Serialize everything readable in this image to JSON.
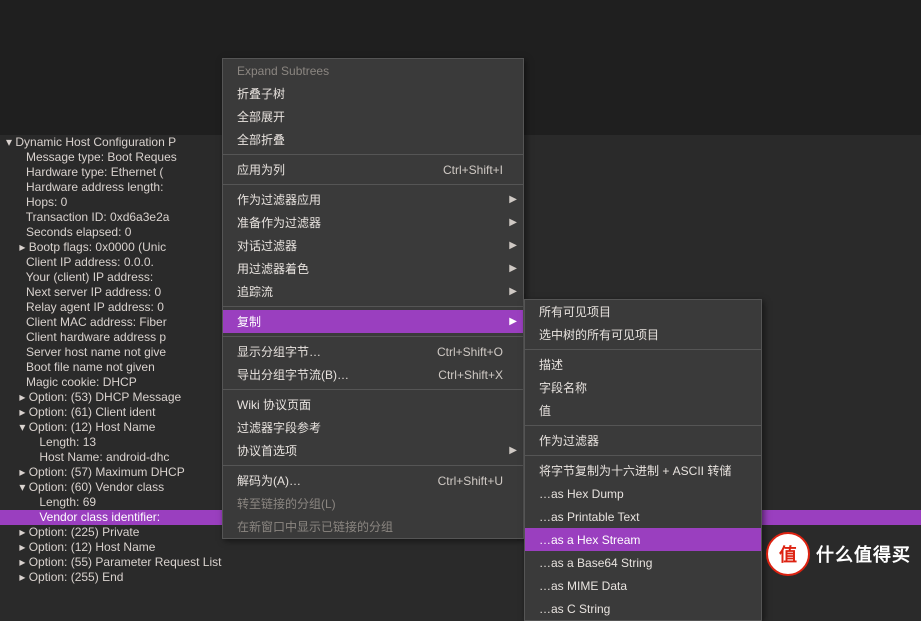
{
  "tree": [
    {
      "indent": 1,
      "caret": "▾",
      "text": "Dynamic Host Configuration P"
    },
    {
      "indent": 3,
      "caret": "",
      "text": "Message type: Boot Reques"
    },
    {
      "indent": 3,
      "caret": "",
      "text": "Hardware type: Ethernet ("
    },
    {
      "indent": 3,
      "caret": "",
      "text": "Hardware address length:"
    },
    {
      "indent": 3,
      "caret": "",
      "text": "Hops: 0"
    },
    {
      "indent": 3,
      "caret": "",
      "text": "Transaction ID: 0xd6a3e2a"
    },
    {
      "indent": 3,
      "caret": "",
      "text": "Seconds elapsed: 0"
    },
    {
      "indent": 3,
      "caret": "▸",
      "text": "Bootp flags: 0x0000 (Unic"
    },
    {
      "indent": 3,
      "caret": "",
      "text": "Client IP address: 0.0.0."
    },
    {
      "indent": 3,
      "caret": "",
      "text": "Your (client) IP address:"
    },
    {
      "indent": 3,
      "caret": "",
      "text": "Next server IP address: 0"
    },
    {
      "indent": 3,
      "caret": "",
      "text": "Relay agent IP address: 0"
    },
    {
      "indent": 3,
      "caret": "",
      "text": "Client MAC address: Fiber"
    },
    {
      "indent": 3,
      "caret": "",
      "text": "Client hardware address p"
    },
    {
      "indent": 3,
      "caret": "",
      "text": "Server host name not give"
    },
    {
      "indent": 3,
      "caret": "",
      "text": "Boot file name not given"
    },
    {
      "indent": 3,
      "caret": "",
      "text": "Magic cookie: DHCP"
    },
    {
      "indent": 3,
      "caret": "▸",
      "text": "Option: (53) DHCP Message"
    },
    {
      "indent": 3,
      "caret": "▸",
      "text": "Option: (61) Client ident"
    },
    {
      "indent": 3,
      "caret": "▾",
      "text": "Option: (12) Host Name"
    },
    {
      "indent": 5,
      "caret": "",
      "text": "Length: 13"
    },
    {
      "indent": 5,
      "caret": "",
      "text": "Host Name: android-dhc"
    },
    {
      "indent": 3,
      "caret": "▸",
      "text": "Option: (57) Maximum DHCP"
    },
    {
      "indent": 3,
      "caret": "▾",
      "text": "Option: (60) Vendor class"
    },
    {
      "indent": 5,
      "caret": "",
      "text": "Length: 69"
    },
    {
      "indent": 5,
      "caret": "",
      "text": "Vendor class identifier:",
      "sel": true
    },
    {
      "indent": 3,
      "caret": "▸",
      "text": "Option: (225) Private"
    },
    {
      "indent": 3,
      "caret": "▸",
      "text": "Option: (12) Host Name"
    },
    {
      "indent": 3,
      "caret": "▸",
      "text": "Option: (55) Parameter Request List"
    },
    {
      "indent": 3,
      "caret": "▸",
      "text": "Option: (255) End"
    }
  ],
  "menu1": [
    {
      "type": "item",
      "label": "Expand Subtrees",
      "disabled": true
    },
    {
      "type": "item",
      "label": "折叠子树"
    },
    {
      "type": "item",
      "label": "全部展开"
    },
    {
      "type": "item",
      "label": "全部折叠"
    },
    {
      "type": "sep"
    },
    {
      "type": "item",
      "label": "应用为列",
      "hotkey": "Ctrl+Shift+I"
    },
    {
      "type": "sep"
    },
    {
      "type": "item",
      "label": "作为过滤器应用",
      "sub": true
    },
    {
      "type": "item",
      "label": "准备作为过滤器",
      "sub": true
    },
    {
      "type": "item",
      "label": "对话过滤器",
      "sub": true
    },
    {
      "type": "item",
      "label": "用过滤器着色",
      "sub": true
    },
    {
      "type": "item",
      "label": "追踪流",
      "sub": true
    },
    {
      "type": "sep"
    },
    {
      "type": "item",
      "label": "复制",
      "sub": true,
      "hl": true
    },
    {
      "type": "sep"
    },
    {
      "type": "item",
      "label": "显示分组字节…",
      "hotkey": "Ctrl+Shift+O"
    },
    {
      "type": "item",
      "label": "导出分组字节流(B)…",
      "hotkey": "Ctrl+Shift+X"
    },
    {
      "type": "sep"
    },
    {
      "type": "item",
      "label": "Wiki 协议页面"
    },
    {
      "type": "item",
      "label": "过滤器字段参考"
    },
    {
      "type": "item",
      "label": "协议首选项",
      "sub": true
    },
    {
      "type": "sep"
    },
    {
      "type": "item",
      "label": "解码为(A)…",
      "hotkey": "Ctrl+Shift+U"
    },
    {
      "type": "item",
      "label": "转至链接的分组(L)",
      "disabled": true
    },
    {
      "type": "item",
      "label": "在新窗口中显示已链接的分组",
      "disabled": true
    }
  ],
  "menu2": [
    {
      "type": "item",
      "label": "所有可见项目"
    },
    {
      "type": "item",
      "label": "选中树的所有可见项目"
    },
    {
      "type": "sep"
    },
    {
      "type": "item",
      "label": "描述"
    },
    {
      "type": "item",
      "label": "字段名称"
    },
    {
      "type": "item",
      "label": "值"
    },
    {
      "type": "sep"
    },
    {
      "type": "item",
      "label": "作为过滤器"
    },
    {
      "type": "sep"
    },
    {
      "type": "item",
      "label": "将字节复制为十六进制 + ASCII 转储"
    },
    {
      "type": "item",
      "label": "…as Hex Dump"
    },
    {
      "type": "item",
      "label": "…as Printable Text"
    },
    {
      "type": "item",
      "label": "…as a Hex Stream",
      "hl": true
    },
    {
      "type": "item",
      "label": "…as a Base64 String"
    },
    {
      "type": "item",
      "label": "…as MIME Data"
    },
    {
      "type": "item",
      "label": "…as C String"
    }
  ],
  "badge": {
    "icon": "值",
    "text": "什么值得买"
  }
}
